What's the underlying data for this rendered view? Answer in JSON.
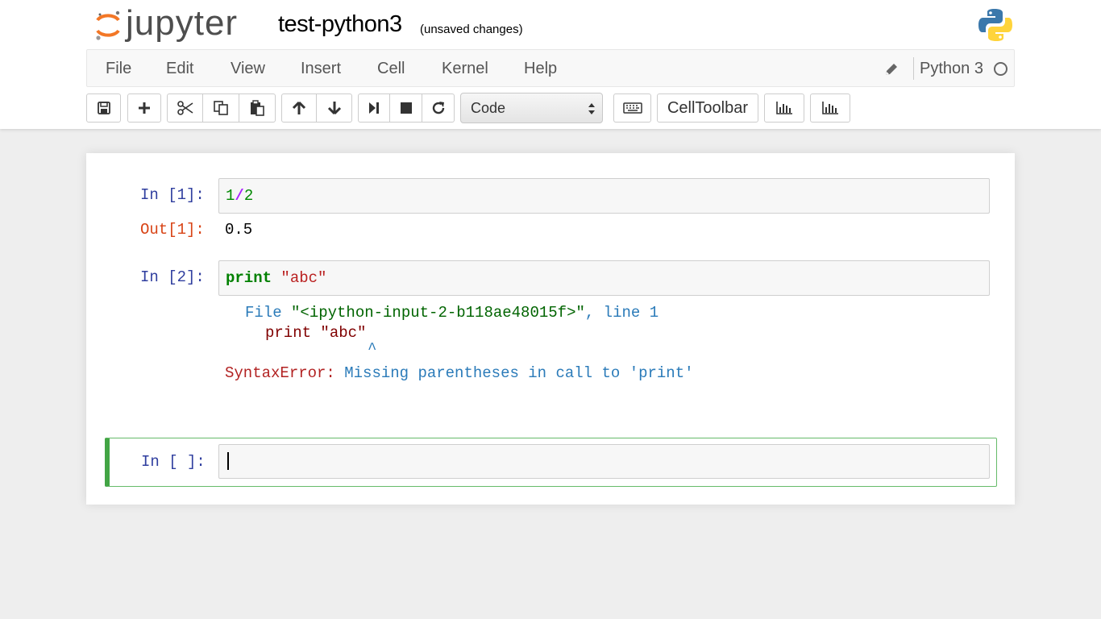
{
  "header": {
    "logo_text": "jupyter",
    "notebook_name": "test-python3",
    "save_status": "(unsaved changes)"
  },
  "menubar": {
    "items": [
      "File",
      "Edit",
      "View",
      "Insert",
      "Cell",
      "Kernel",
      "Help"
    ],
    "kernel_name": "Python 3"
  },
  "toolbar": {
    "cell_type": "Code",
    "celltoolbar_label": "CellToolbar"
  },
  "cells": {
    "c1": {
      "in_prompt": "In [1]:",
      "code": {
        "num1": "1",
        "op": "/",
        "num2": "2"
      },
      "out_prompt": "Out[1]:",
      "output": "0.5"
    },
    "c2": {
      "in_prompt": "In [2]:",
      "code": {
        "kw": "print",
        "str": "\"abc\""
      },
      "traceback": {
        "file_label": "File",
        "file_path": "\"<ipython-input-2-b118ae48015f>\"",
        "line_label": ", line 1",
        "code_kw": "print",
        "code_str": "\"abc\"",
        "caret": "^",
        "error_type": "SyntaxError:",
        "error_msg": "Missing parentheses in call to 'print'"
      }
    },
    "c3": {
      "in_prompt": "In [ ]:"
    }
  }
}
